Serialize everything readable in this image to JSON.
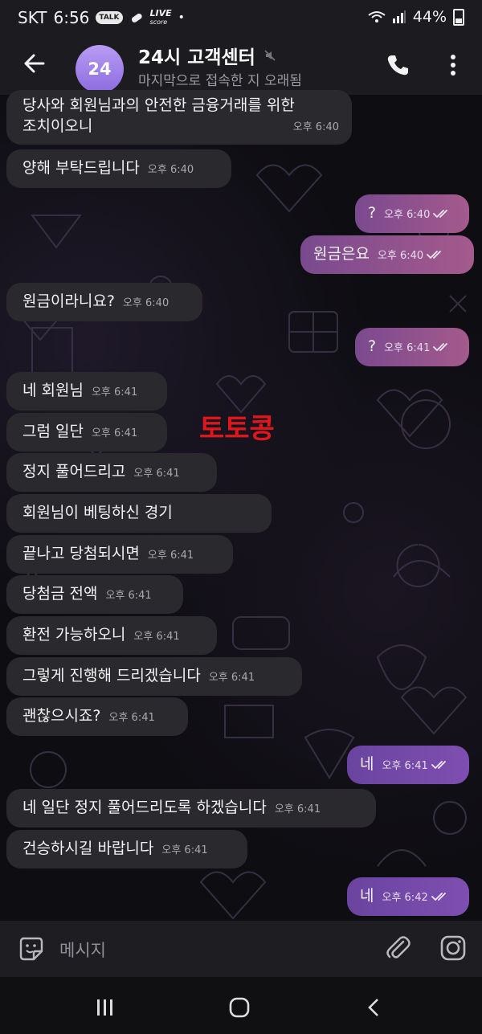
{
  "status": {
    "carrier": "SKT",
    "time": "6:56",
    "badge_talk": "TALK",
    "badge_live": "LIVE",
    "badge_score": "score",
    "dot": "•",
    "battery": "44%"
  },
  "header": {
    "avatar_text": "24",
    "title": "24시 고객센터",
    "subtitle": "마지막으로 접속한 지 오래됨"
  },
  "messages": [
    {
      "dir": "in",
      "text": "당사와 회원님과의 안전한 금융거래를 위한",
      "text2": "조치이오니",
      "time": "오후 6:40"
    },
    {
      "dir": "in",
      "text": "양해 부탁드립니다",
      "time": "오후 6:40"
    },
    {
      "dir": "out",
      "text": "?",
      "time": "오후 6:40"
    },
    {
      "dir": "out",
      "text": "원금은요",
      "time": "오후 6:40"
    },
    {
      "dir": "in",
      "text": "원금이라니요?",
      "time": "오후 6:40"
    },
    {
      "dir": "out",
      "text": "?",
      "time": "오후 6:41"
    },
    {
      "dir": "in",
      "text": "네 회원님",
      "time": "오후 6:41"
    },
    {
      "dir": "in",
      "text": "그럼 일단",
      "time": "오후 6:41"
    },
    {
      "dir": "in",
      "text": "정지 풀어드리고",
      "time": "오후 6:41"
    },
    {
      "dir": "in",
      "text": "회원님이 베팅하신 경기",
      "time": ""
    },
    {
      "dir": "in",
      "text": "끝나고 당첨되시면",
      "time": "오후 6:41"
    },
    {
      "dir": "in",
      "text": "당첨금 전액",
      "time": "오후 6:41"
    },
    {
      "dir": "in",
      "text": "환전 가능하오니",
      "time": "오후 6:41"
    },
    {
      "dir": "in",
      "text": "그렇게 진행해 드리겠습니다",
      "time": "오후 6:41"
    },
    {
      "dir": "in",
      "text": "괜찮으시죠?",
      "time": "오후 6:41"
    },
    {
      "dir": "out",
      "text": "네",
      "time": "오후 6:41"
    },
    {
      "dir": "in",
      "text": "네 일단 정지 풀어드리도록 하겠습니다",
      "time": "오후 6:41"
    },
    {
      "dir": "in",
      "text": "건승하시길 바랍니다",
      "time": "오후 6:41"
    },
    {
      "dir": "out",
      "text": "네",
      "time": "오후 6:42"
    }
  ],
  "watermark": "토토콩",
  "input": {
    "placeholder": "메시지"
  },
  "colors": {
    "incoming": "#2a2a2e",
    "outgoing": "#a45a8c",
    "accent": "#8c6be0",
    "watermark": "#e0161b"
  },
  "icons": [
    "back-arrow-icon",
    "mute-icon",
    "phone-icon",
    "more-vert-icon",
    "sticker-icon",
    "paperclip-icon",
    "instagram-camera-icon",
    "read-checks-icon"
  ]
}
